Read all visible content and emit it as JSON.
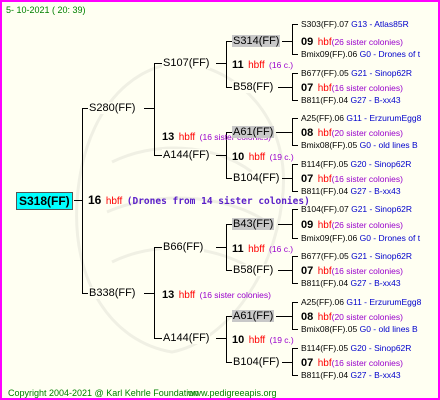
{
  "header": {
    "date": "5-  10-2021  (  20:  39)"
  },
  "footer": {
    "copyright": "Copyright 2004-2021 @ Karl Kehrle Foundation",
    "site": "www.pedigreeapis.org"
  },
  "root": {
    "name": "S318(FF)",
    "year": "16",
    "hb": "hbff",
    "note": "(Drones from 14 sister colonies)"
  },
  "gen1": [
    {
      "name": "S280(FF)",
      "year": "13",
      "hb": "hbff",
      "note": "(16 sister colonies)"
    },
    {
      "name": "B338(FF)",
      "year": "13",
      "hb": "hbff",
      "note": "(16 sister colonies)"
    }
  ],
  "gen2": [
    {
      "name": "S107(FF)",
      "year": "11",
      "hb": "hbff",
      "note": "(16 c.)"
    },
    {
      "name": "A144(FF)",
      "year": "10",
      "hb": "hbff",
      "note": "(19 c.)"
    },
    {
      "name": "B66(FF)",
      "year": "11",
      "hb": "hbff",
      "note": "(16 c.)"
    },
    {
      "name": "A144(FF)",
      "year": "10",
      "hb": "hbff",
      "note": "(19 c.)"
    }
  ],
  "gen3": [
    {
      "name": "S314(FF)",
      "year": "09",
      "hb": "hbf",
      "note": "(26 sister colonies)"
    },
    {
      "name": "B58(FF)",
      "year": "07",
      "hb": "hbf",
      "note": "(16 sister colonies)"
    },
    {
      "name": "A61(FF)",
      "year": "08",
      "hb": "hbf",
      "note": "(20 sister colonies)"
    },
    {
      "name": "B104(FF)",
      "year": "07",
      "hb": "hbf",
      "note": "(16 sister colonies)"
    },
    {
      "name": "B43(FF)",
      "year": "09",
      "hb": "hbf",
      "note": "(26 sister colonies)"
    },
    {
      "name": "B58(FF)",
      "year": "07",
      "hb": "hbf",
      "note": "(16 sister colonies)"
    },
    {
      "name": "A61(FF)",
      "year": "08",
      "hb": "hbf",
      "note": "(20 sister colonies)"
    },
    {
      "name": "B104(FF)",
      "year": "07",
      "hb": "hbf",
      "note": "(16 sister colonies)"
    }
  ],
  "gen4": [
    {
      "id": "S303(FF).07",
      "code": "G13 - Atlas85R"
    },
    {
      "id": "Bmix09(FF).06",
      "code": "G0 - Drones of t"
    },
    {
      "id": "B677(FF).05",
      "code": "G21 - Sinop62R"
    },
    {
      "id": "B811(FF).04",
      "code": "G27 - B-xx43"
    },
    {
      "id": "A25(FF).06",
      "code": "G11 - ErzurumEgg8"
    },
    {
      "id": "Bmix08(FF).05",
      "code": "G0 - old lines B"
    },
    {
      "id": "B114(FF).05",
      "code": "G20 - Sinop62R"
    },
    {
      "id": "B811(FF).04",
      "code": "G27 - B-xx43"
    },
    {
      "id": "B104(FF).07",
      "code": "G21 - Sinop62R"
    },
    {
      "id": "Bmix09(FF).06",
      "code": "G0 - Drones of t"
    },
    {
      "id": "B677(FF).05",
      "code": "G21 - Sinop62R"
    },
    {
      "id": "B811(FF).04",
      "code": "G27 - B-xx43"
    },
    {
      "id": "A25(FF).06",
      "code": "G11 - ErzurumEgg8"
    },
    {
      "id": "Bmix08(FF).05",
      "code": "G0 - old lines B"
    },
    {
      "id": "B114(FF).05",
      "code": "G20 - Sinop62R"
    },
    {
      "id": "B811(FF).04",
      "code": "G27 - B-xx43"
    }
  ]
}
